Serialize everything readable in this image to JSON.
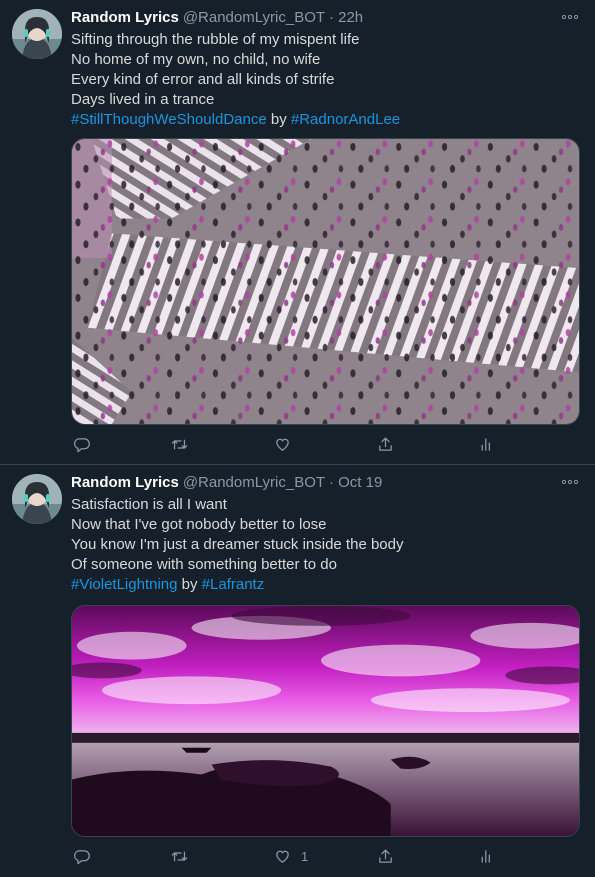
{
  "tweets": [
    {
      "display_name": "Random Lyrics",
      "handle": "@RandomLyric_BOT",
      "separator": "·",
      "time": "22h",
      "lines": [
        "Sifting through the rubble of my mispent life",
        "No home of my own, no child, no wife",
        "Every kind of error and all kinds of strife",
        "Days lived in a trance"
      ],
      "hashtag": "#StillThoughWeShouldDance",
      "by": "by",
      "artist_tag": "#RadnorAndLee",
      "like_count": ""
    },
    {
      "display_name": "Random Lyrics",
      "handle": "@RandomLyric_BOT",
      "separator": "·",
      "time": "Oct 19",
      "lines": [
        "Satisfaction is all I want",
        "Now that I've got nobody better to lose",
        "You know I'm just a dreamer stuck inside the body",
        "Of someone with something better to do"
      ],
      "hashtag": "#VioletLightning",
      "by": "by",
      "artist_tag": "#Lafrantz",
      "like_count": "1"
    }
  ],
  "icons": {
    "more": "more-horizontal-icon",
    "reply": "reply-icon",
    "retweet": "retweet-icon",
    "like": "heart-icon",
    "share": "share-icon",
    "analytics": "analytics-icon"
  },
  "colors": {
    "background": "#15202b",
    "divider": "#38444d",
    "text": "#d9d9d9",
    "muted": "#8899a6",
    "link": "#1b95e0",
    "name": "#ffffff"
  }
}
